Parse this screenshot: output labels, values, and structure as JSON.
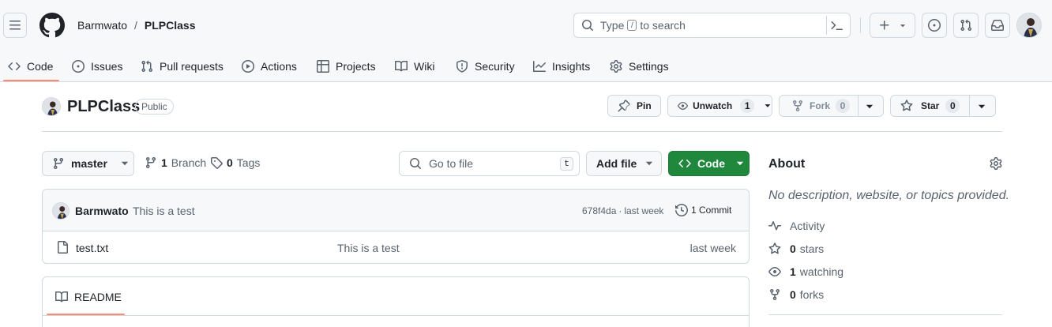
{
  "header": {
    "owner": "Barmwato",
    "separator": "/",
    "repo": "PLPClass",
    "search": {
      "prefix": "Type",
      "key": "/",
      "suffix": "to search"
    }
  },
  "nav": {
    "tabs": [
      {
        "label": "Code",
        "icon": "code-icon",
        "active": true
      },
      {
        "label": "Issues",
        "icon": "issue-icon"
      },
      {
        "label": "Pull requests",
        "icon": "pull-request-icon"
      },
      {
        "label": "Actions",
        "icon": "play-icon"
      },
      {
        "label": "Projects",
        "icon": "table-icon"
      },
      {
        "label": "Wiki",
        "icon": "book-icon"
      },
      {
        "label": "Security",
        "icon": "shield-icon"
      },
      {
        "label": "Insights",
        "icon": "graph-icon"
      },
      {
        "label": "Settings",
        "icon": "gear-icon"
      }
    ]
  },
  "repo_header": {
    "name": "PLPClass",
    "visibility": "Public",
    "pin_label": "Pin",
    "unwatch_label": "Unwatch",
    "watch_count": "1",
    "fork_label": "Fork",
    "fork_count": "0",
    "star_label": "Star",
    "star_count": "0"
  },
  "file_nav": {
    "branch": "master",
    "branch_count": "1",
    "branch_label": "Branch",
    "tag_count": "0",
    "tag_label": "Tags",
    "goto_placeholder": "Go to file",
    "goto_key": "t",
    "add_file_label": "Add file",
    "code_label": "Code"
  },
  "latest_commit": {
    "author": "Barmwato",
    "message": "This is a test",
    "hash": "678f4da",
    "dot": "·",
    "time": "last week",
    "commit_count_label": "1 Commit"
  },
  "files": [
    {
      "name": "test.txt",
      "message": "This is a test",
      "time": "last week",
      "icon": "file-icon"
    }
  ],
  "readme": {
    "label": "README"
  },
  "about": {
    "title": "About",
    "description": "No description, website, or topics provided.",
    "activity_label": "Activity",
    "stars_count": "0",
    "stars_label": "stars",
    "watching_count": "1",
    "watching_label": "watching",
    "forks_count": "0",
    "forks_label": "forks"
  },
  "colors": {
    "header_bg": "#f6f8fa",
    "border": "#d1d9e0",
    "accent_underline": "#fd8c73",
    "primary_green": "#1f883d",
    "muted_text": "#59636e"
  }
}
